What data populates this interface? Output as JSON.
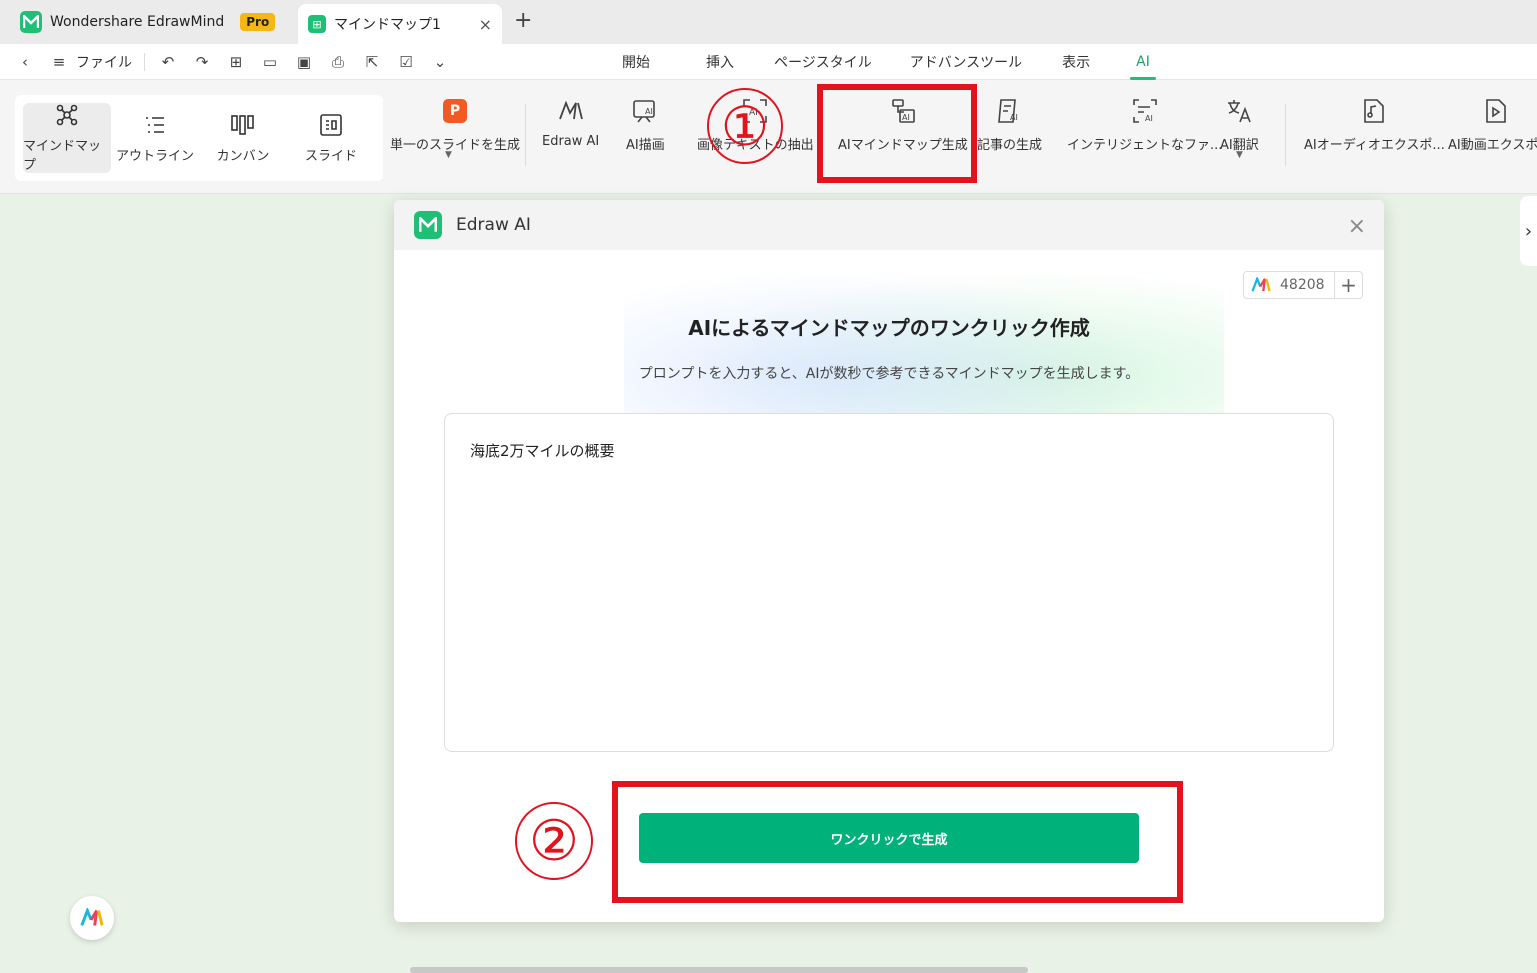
{
  "titlebar": {
    "app_name": "Wondershare EdrawMind",
    "pro_badge": "Pro",
    "doc_tab": "マインドマップ1",
    "close_glyph": "×",
    "new_tab_glyph": "+"
  },
  "menubar": {
    "file_label": "ファイル",
    "tabs": [
      {
        "label": "開始"
      },
      {
        "label": "挿入"
      },
      {
        "label": "ページスタイル"
      },
      {
        "label": "アドバンスツール"
      },
      {
        "label": "表示"
      },
      {
        "label": "AI",
        "active": true
      }
    ]
  },
  "ribbon": {
    "views": [
      {
        "label": "マインドマップ",
        "icon": "mindmap-icon",
        "selected": true
      },
      {
        "label": "アウトライン",
        "icon": "outline-icon"
      },
      {
        "label": "カンバン",
        "icon": "kanban-icon"
      },
      {
        "label": "スライド",
        "icon": "slide-icon"
      }
    ],
    "tools": [
      {
        "label": "単一のスライドを生成",
        "icon": "ppt-icon"
      },
      {
        "label": "Edraw AI",
        "icon": "edraw-ai-icon"
      },
      {
        "label": "AI描画",
        "icon": "ai-draw-icon"
      },
      {
        "label": "画像テキストの抽出",
        "icon": "image-text-icon"
      },
      {
        "label": "AIマインドマップ生成",
        "icon": "ai-mindmap-icon"
      },
      {
        "label": "記事の生成",
        "icon": "article-icon"
      },
      {
        "label": "インテリジェントなファ...",
        "icon": "intelligent-file-icon"
      },
      {
        "label": "AI翻訳",
        "icon": "translate-icon"
      },
      {
        "label": "AIオーディオエクスポ...",
        "icon": "audio-export-icon"
      },
      {
        "label": "AI動画エクスポ-",
        "icon": "video-export-icon"
      }
    ]
  },
  "annotations": {
    "step1": "①",
    "step2": "②",
    "color": "#e1141e"
  },
  "dialog": {
    "title": "Edraw AI",
    "close_glyph": "×",
    "credits": "48208",
    "credits_plus": "+",
    "heading": "AIによるマインドマップのワンクリック作成",
    "subtitle": "プロンプトを入力すると、AIが数秒で参考できるマインドマップを生成します。",
    "prompt_value": "海底2万マイルの概要",
    "generate_button": "ワンクリックで生成",
    "button_color": "#00b27a"
  },
  "side_tab_glyph": "›"
}
